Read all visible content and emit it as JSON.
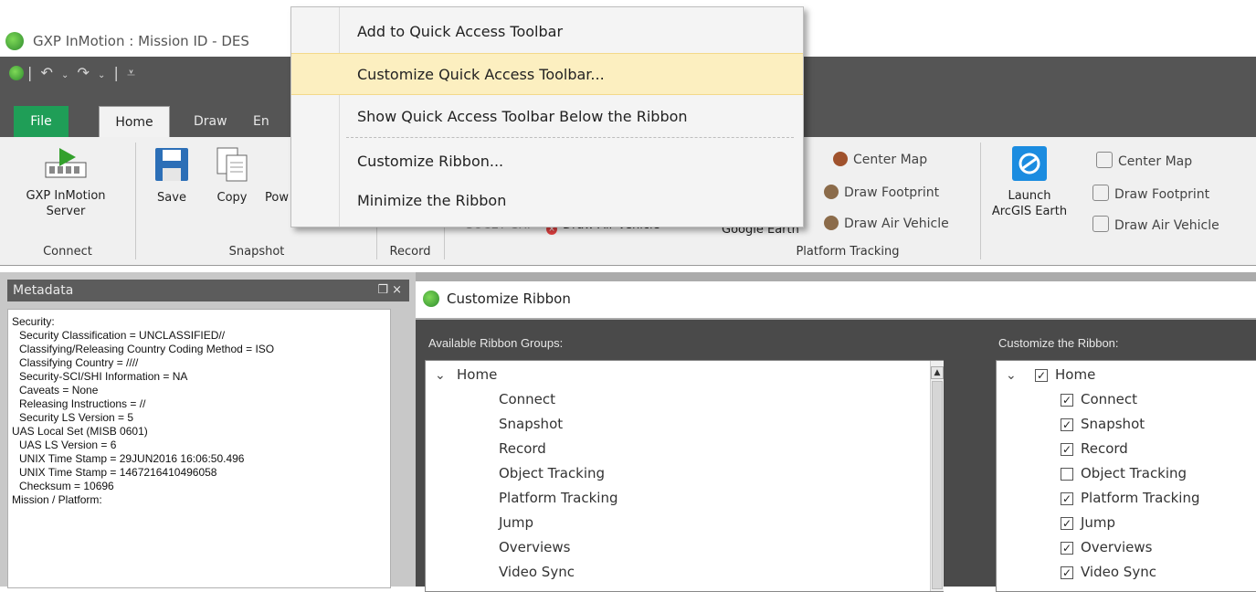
{
  "window": {
    "title": "GXP InMotion : Mission ID - DES"
  },
  "tabs": {
    "file": "File",
    "home": "Home",
    "draw": "Draw",
    "en": "En"
  },
  "ribbon": {
    "connect": {
      "btn1": "GXP InMotion",
      "btn2": "Server",
      "group": "Connect"
    },
    "snapshot": {
      "save": "Save",
      "copy": "Copy",
      "pow": "Pow",
      "group": "Snapshot"
    },
    "record": {
      "group": "Record"
    },
    "platform": {
      "group": "Platform Tracking",
      "socet": "SOCET GXP",
      "draw_air_vehicle_hidden": "Draw Air Vehicle",
      "google_earth": "Google Earth",
      "center_map_1": "Center Map",
      "draw_footprint_1": "Draw Footprint",
      "draw_air_vehicle_1": "Draw Air Vehicle",
      "launch_1": "Launch",
      "launch_2": "ArcGIS Earth",
      "center_map_2": "Center Map",
      "draw_footprint_2": "Draw Footprint",
      "draw_air_vehicle_2": "Draw Air Vehicle"
    }
  },
  "context_menu": {
    "items": [
      "Add to Quick Access Toolbar",
      "Customize Quick Access Toolbar...",
      "Show Quick Access Toolbar Below the Ribbon",
      "Customize Ribbon...",
      "Minimize the Ribbon"
    ],
    "highlighted_index": 1
  },
  "metadata_panel": {
    "title": "Metadata",
    "controls": "❒ ×",
    "lines": [
      "Security:",
      "  Security Classification = UNCLASSIFIED//",
      "  Classifying/Releasing Country Coding Method = ISO",
      "  Classifying Country = ////",
      "  Security-SCI/SHI Information = NA",
      "  Caveats = None",
      "  Releasing Instructions = //",
      "  Security LS Version = 5",
      "UAS Local Set (MISB 0601)",
      "  UAS LS Version = 6",
      "  UNIX Time Stamp = 29JUN2016 16:06:50.496",
      "  UNIX Time Stamp = 1467216410496058",
      "  Checksum = 10696",
      "Mission / Platform:"
    ]
  },
  "customize_ribbon": {
    "title": "Customize Ribbon",
    "available_label": "Available Ribbon Groups:",
    "customize_label": "Customize the Ribbon:",
    "available_root": "Home",
    "available_items": [
      "Connect",
      "Snapshot",
      "Record",
      "Object Tracking",
      "Platform Tracking",
      "Jump",
      "Overviews",
      "Video Sync"
    ],
    "custom_root": "Home",
    "custom_items": [
      {
        "label": "Connect",
        "checked": true
      },
      {
        "label": "Snapshot",
        "checked": true
      },
      {
        "label": "Record",
        "checked": true
      },
      {
        "label": "Object Tracking",
        "checked": false
      },
      {
        "label": "Platform Tracking",
        "checked": true
      },
      {
        "label": "Jump",
        "checked": true
      },
      {
        "label": "Overviews",
        "checked": true
      },
      {
        "label": "Video Sync",
        "checked": true
      }
    ]
  },
  "colors": {
    "file_tab": "#1f9e57",
    "highlight": "#fcefc0",
    "ribbon_dark": "#555555"
  }
}
